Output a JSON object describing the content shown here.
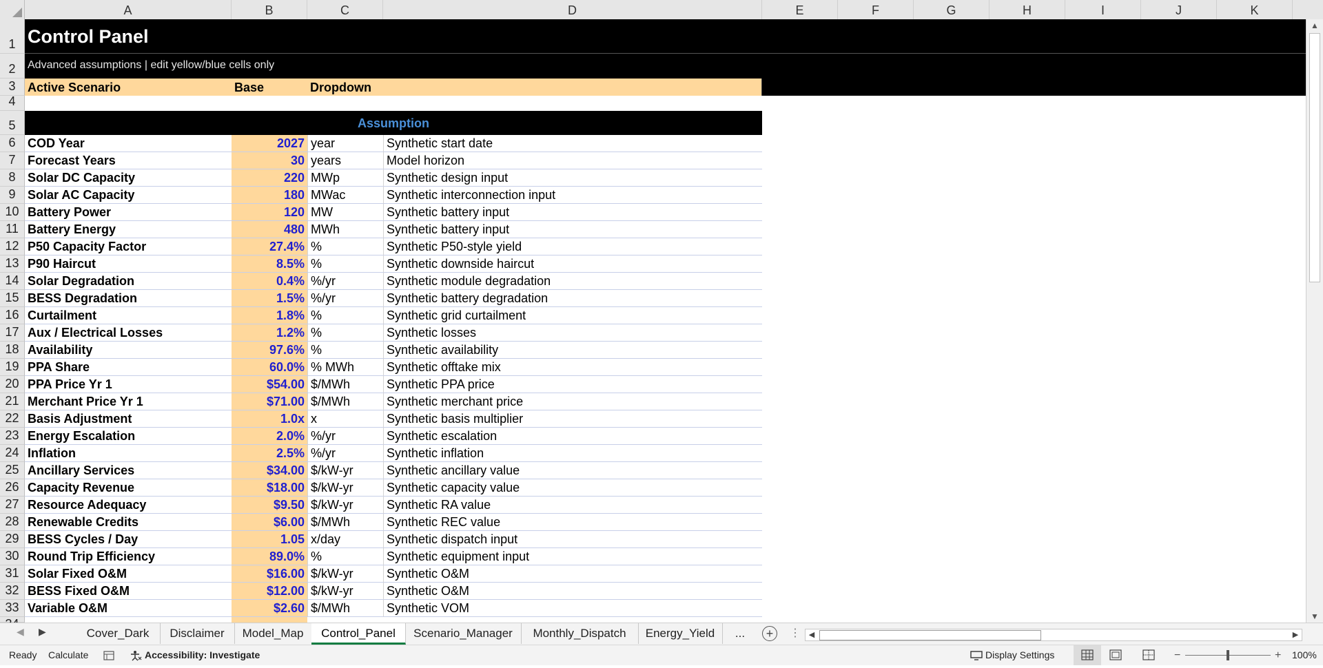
{
  "columns": [
    "A",
    "B",
    "C",
    "D",
    "E",
    "F",
    "G",
    "H",
    "I",
    "J",
    "K"
  ],
  "title": "Control Panel",
  "subtitle": "Advanced assumptions | edit yellow/blue cells only",
  "scenario": {
    "label": "Active Scenario",
    "value": "Base",
    "note": "Dropdown"
  },
  "section_header": "Assumption",
  "rows": [
    {
      "n": "6",
      "label": "COD Year",
      "value": "2027",
      "unit": "year",
      "note": "Synthetic start date"
    },
    {
      "n": "7",
      "label": "Forecast Years",
      "value": "30",
      "unit": "years",
      "note": "Model horizon"
    },
    {
      "n": "8",
      "label": "Solar DC Capacity",
      "value": "220",
      "unit": "MWp",
      "note": "Synthetic design input"
    },
    {
      "n": "9",
      "label": "Solar AC Capacity",
      "value": "180",
      "unit": "MWac",
      "note": "Synthetic interconnection input"
    },
    {
      "n": "10",
      "label": "Battery Power",
      "value": "120",
      "unit": "MW",
      "note": "Synthetic battery input"
    },
    {
      "n": "11",
      "label": "Battery Energy",
      "value": "480",
      "unit": "MWh",
      "note": "Synthetic battery input"
    },
    {
      "n": "12",
      "label": "P50 Capacity Factor",
      "value": "27.4%",
      "unit": "%",
      "note": "Synthetic P50-style yield"
    },
    {
      "n": "13",
      "label": "P90 Haircut",
      "value": "8.5%",
      "unit": "%",
      "note": "Synthetic downside haircut"
    },
    {
      "n": "14",
      "label": "Solar Degradation",
      "value": "0.4%",
      "unit": "%/yr",
      "note": "Synthetic module degradation"
    },
    {
      "n": "15",
      "label": "BESS Degradation",
      "value": "1.5%",
      "unit": "%/yr",
      "note": "Synthetic battery degradation"
    },
    {
      "n": "16",
      "label": "Curtailment",
      "value": "1.8%",
      "unit": "%",
      "note": "Synthetic grid curtailment"
    },
    {
      "n": "17",
      "label": "Aux / Electrical Losses",
      "value": "1.2%",
      "unit": "%",
      "note": "Synthetic losses"
    },
    {
      "n": "18",
      "label": "Availability",
      "value": "97.6%",
      "unit": "%",
      "note": "Synthetic availability"
    },
    {
      "n": "19",
      "label": "PPA Share",
      "value": "60.0%",
      "unit": "% MWh",
      "note": "Synthetic offtake mix"
    },
    {
      "n": "20",
      "label": "PPA Price Yr 1",
      "value": "$54.00",
      "unit": "$/MWh",
      "note": "Synthetic PPA price"
    },
    {
      "n": "21",
      "label": "Merchant Price Yr 1",
      "value": "$71.00",
      "unit": "$/MWh",
      "note": "Synthetic merchant price"
    },
    {
      "n": "22",
      "label": "Basis Adjustment",
      "value": "1.0x",
      "unit": "x",
      "note": "Synthetic basis multiplier"
    },
    {
      "n": "23",
      "label": "Energy Escalation",
      "value": "2.0%",
      "unit": "%/yr",
      "note": "Synthetic escalation"
    },
    {
      "n": "24",
      "label": "Inflation",
      "value": "2.5%",
      "unit": "%/yr",
      "note": "Synthetic inflation"
    },
    {
      "n": "25",
      "label": "Ancillary Services",
      "value": "$34.00",
      "unit": "$/kW-yr",
      "note": "Synthetic ancillary value"
    },
    {
      "n": "26",
      "label": "Capacity Revenue",
      "value": "$18.00",
      "unit": "$/kW-yr",
      "note": "Synthetic capacity value"
    },
    {
      "n": "27",
      "label": "Resource Adequacy",
      "value": "$9.50",
      "unit": "$/kW-yr",
      "note": "Synthetic RA value"
    },
    {
      "n": "28",
      "label": "Renewable Credits",
      "value": "$6.00",
      "unit": "$/MWh",
      "note": "Synthetic REC value"
    },
    {
      "n": "29",
      "label": "BESS Cycles / Day",
      "value": "1.05",
      "unit": "x/day",
      "note": "Synthetic dispatch input"
    },
    {
      "n": "30",
      "label": "Round Trip Efficiency",
      "value": "89.0%",
      "unit": "%",
      "note": "Synthetic equipment input"
    },
    {
      "n": "31",
      "label": "Solar Fixed O&M",
      "value": "$16.00",
      "unit": "$/kW-yr",
      "note": "Synthetic O&M"
    },
    {
      "n": "32",
      "label": "BESS Fixed O&M",
      "value": "$12.00",
      "unit": "$/kW-yr",
      "note": "Synthetic O&M"
    },
    {
      "n": "33",
      "label": "Variable O&M",
      "value": "$2.60",
      "unit": "$/MWh",
      "note": "Synthetic VOM"
    }
  ],
  "tabs": [
    "Cover_Dark",
    "Disclaimer",
    "Model_Map",
    "Control_Panel",
    "Scenario_Manager",
    "Monthly_Dispatch",
    "Energy_Yield"
  ],
  "tab_overflow": "...",
  "active_tab": "Control_Panel",
  "status": {
    "ready": "Ready",
    "calculate": "Calculate",
    "accessibility": "Accessibility: Investigate",
    "display_settings": "Display Settings",
    "zoom": "100%"
  },
  "colors": {
    "header_bg": "#000000",
    "input_bg": "#ffd89c",
    "input_text": "#1f1fd0",
    "accent": "#107c41",
    "section_text": "#4a90d9"
  }
}
